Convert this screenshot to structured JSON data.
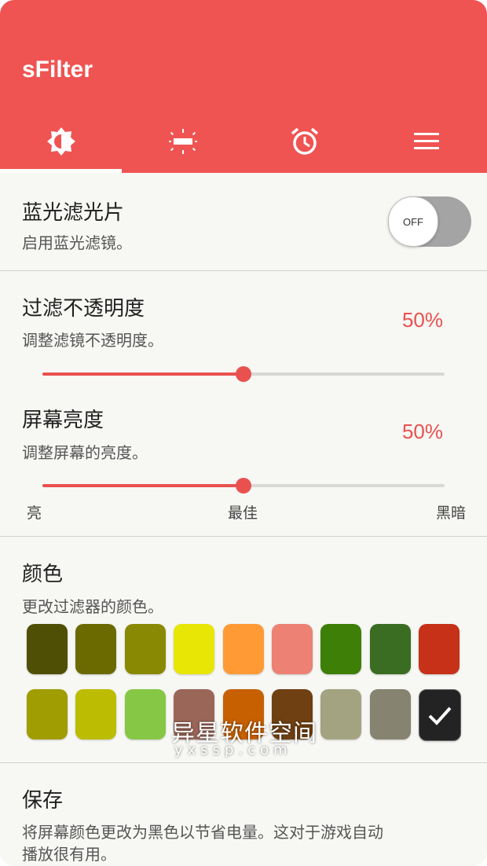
{
  "app": {
    "title": "sFilter"
  },
  "tabs": [
    {
      "name": "filter",
      "icon": "brightness-icon",
      "selected": true
    },
    {
      "name": "screen",
      "icon": "screen-dim-icon",
      "selected": false
    },
    {
      "name": "schedule",
      "icon": "alarm-icon",
      "selected": false
    },
    {
      "name": "menu",
      "icon": "menu-icon",
      "selected": false
    }
  ],
  "blue_filter": {
    "title": "蓝光滤光片",
    "subtitle": "启用蓝光滤镜。",
    "toggle_label": "OFF",
    "enabled": false
  },
  "opacity": {
    "title": "过滤不透明度",
    "subtitle": "调整滤镜不透明度。",
    "value_text": "50%",
    "value": 0.5
  },
  "brightness": {
    "title": "屏幕亮度",
    "subtitle": "调整屏幕的亮度。",
    "value_text": "50%",
    "value": 0.5,
    "scale_left": "亮",
    "scale_mid": "最佳",
    "scale_right": "黑暗"
  },
  "color": {
    "title": "颜色",
    "subtitle": "更改过滤器的颜色。",
    "swatches": [
      "#4f4f05",
      "#6b6a00",
      "#8a8903",
      "#e8e605",
      "#ff9a35",
      "#ec8174",
      "#3d7f07",
      "#3a6d22",
      "#c63118",
      "#a09d02",
      "#bcbc02",
      "#86c845",
      "#9a6658",
      "#c66001",
      "#6f4012",
      "#a3a382",
      "#868470",
      "#232323"
    ],
    "selected_index": 17
  },
  "save": {
    "title": "保存",
    "subtitle_line1": "将屏幕颜色更改为黑色以节省电量。这对于游戏自动",
    "subtitle_line2": "播放很有用。"
  },
  "watermark": {
    "text": "异星软件空间",
    "sub": "yxssp.com"
  },
  "colors": {
    "accent": "#ef5452",
    "toggle_off": "#a4a4a4"
  }
}
